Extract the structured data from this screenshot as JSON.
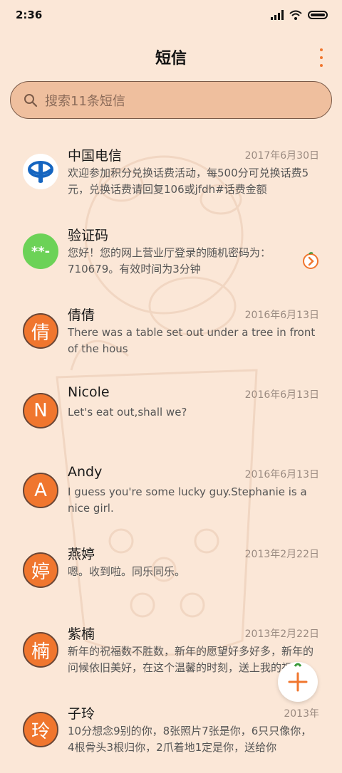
{
  "status": {
    "time": "2:36"
  },
  "header": {
    "title": "短信"
  },
  "search": {
    "placeholder": "搜索11条短信"
  },
  "conversations": [
    {
      "name": "中国电信",
      "date": "2017年6月30日",
      "preview": "欢迎参加积分兑换话费活动，每500分可兑换话费5元，兑换话费请回复106或jfdh#话费金额",
      "avatar_text": "",
      "avatar_icon": "china-telecom-logo"
    },
    {
      "name": "验证码",
      "date": "",
      "preview": "您好！您的网上营业厅登录的随机密码为：710679。有效时间为3分钟",
      "avatar_text": "**-",
      "avatar_icon": "verification-code-icon"
    },
    {
      "name": "倩倩",
      "date": "2016年6月13日",
      "preview": "There was a table set out under a tree in front of the hous",
      "avatar_text": "倩"
    },
    {
      "name": "Nicole",
      "date": "2016年6月13日",
      "preview": "Let's eat out,shall we?",
      "avatar_text": "N"
    },
    {
      "name": "Andy",
      "date": "2016年6月13日",
      "preview": "I guess you're some lucky guy.Stephanie is a nice girl.",
      "avatar_text": "A"
    },
    {
      "name": "燕婷",
      "date": "2013年2月22日",
      "preview": "嗯。收到啦。同乐同乐。",
      "avatar_text": "婷"
    },
    {
      "name": "紫楠",
      "date": "2013年2月22日",
      "preview": "新年的祝福数不胜数，新年的愿望好多好多，新年的问候依旧美好，在这个温馨的时刻，送上我的祝福",
      "avatar_text": "楠"
    },
    {
      "name": "子玲",
      "date": "2013年",
      "preview": "10分想念9别的你，8张照片7张是你，6只只像你，4根骨头3根归你，2爪着地1定是你，送给你",
      "avatar_text": "玲"
    }
  ],
  "colors": {
    "accent": "#f0762e",
    "background": "#fbe7d7",
    "search_bg": "#efbf9e",
    "green_avatar": "#6cd257"
  }
}
